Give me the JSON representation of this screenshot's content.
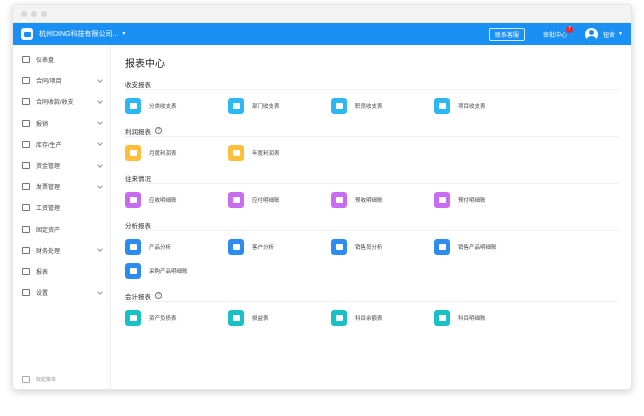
{
  "header": {
    "company": "杭州DING科技有限公司...",
    "contact": "联系客服",
    "approval": "审批中心",
    "approval_badge": "7",
    "user": "钮舍"
  },
  "sidebar": {
    "items": [
      {
        "label": "仪表盘",
        "icon": "dashboard-icon",
        "expand": false
      },
      {
        "label": "合同/项目",
        "icon": "folder-icon",
        "expand": true
      },
      {
        "label": "合同收款/收支",
        "icon": "folder-icon",
        "expand": true
      },
      {
        "label": "报销",
        "icon": "receipt-icon",
        "expand": true
      },
      {
        "label": "库存/生产",
        "icon": "box-icon",
        "expand": true
      },
      {
        "label": "资金管理",
        "icon": "wallet-icon",
        "expand": true
      },
      {
        "label": "发票管理",
        "icon": "invoice-icon",
        "expand": true
      },
      {
        "label": "工资管理",
        "icon": "salary-icon",
        "expand": false
      },
      {
        "label": "固定资产",
        "icon": "asset-icon",
        "expand": false
      },
      {
        "label": "财务处理",
        "icon": "finance-icon",
        "expand": true
      },
      {
        "label": "报表",
        "icon": "chart-icon",
        "expand": false
      },
      {
        "label": "设置",
        "icon": "settings-icon",
        "expand": true
      }
    ],
    "footer": "收起菜单"
  },
  "main": {
    "title": "报表中心",
    "sections": [
      {
        "title": "收支报表",
        "help": false,
        "items": [
          {
            "label": "分类收支表",
            "color": "#2db7f5"
          },
          {
            "label": "部门收支表",
            "color": "#2db7f5"
          },
          {
            "label": "职员收支表",
            "color": "#2db7f5"
          },
          {
            "label": "项目收支表",
            "color": "#2db7f5"
          }
        ]
      },
      {
        "title": "利润报表",
        "help": true,
        "items": [
          {
            "label": "月度利润表",
            "color": "#ffbf3a"
          },
          {
            "label": "年度利润表",
            "color": "#ffbf3a"
          }
        ]
      },
      {
        "title": "往来情况",
        "help": false,
        "items": [
          {
            "label": "应收明细账",
            "color": "#c86cf0"
          },
          {
            "label": "应付明细账",
            "color": "#c86cf0"
          },
          {
            "label": "预收明细账",
            "color": "#c86cf0"
          },
          {
            "label": "预付明细账",
            "color": "#c86cf0"
          }
        ]
      },
      {
        "title": "分析报表",
        "help": false,
        "items": [
          {
            "label": "产品分析",
            "color": "#2d8cf0"
          },
          {
            "label": "客户分析",
            "color": "#2d8cf0"
          },
          {
            "label": "销售员分析",
            "color": "#2d8cf0"
          },
          {
            "label": "销售产品明细账",
            "color": "#2d8cf0"
          },
          {
            "label": "采购产品明细账",
            "color": "#2d8cf0"
          }
        ]
      },
      {
        "title": "会计报表",
        "help": true,
        "items": [
          {
            "label": "资产负债表",
            "color": "#19c1c6"
          },
          {
            "label": "损益表",
            "color": "#19c1c6"
          },
          {
            "label": "科目余额表",
            "color": "#19c1c6"
          },
          {
            "label": "科目明细账",
            "color": "#19c1c6"
          }
        ]
      }
    ]
  }
}
